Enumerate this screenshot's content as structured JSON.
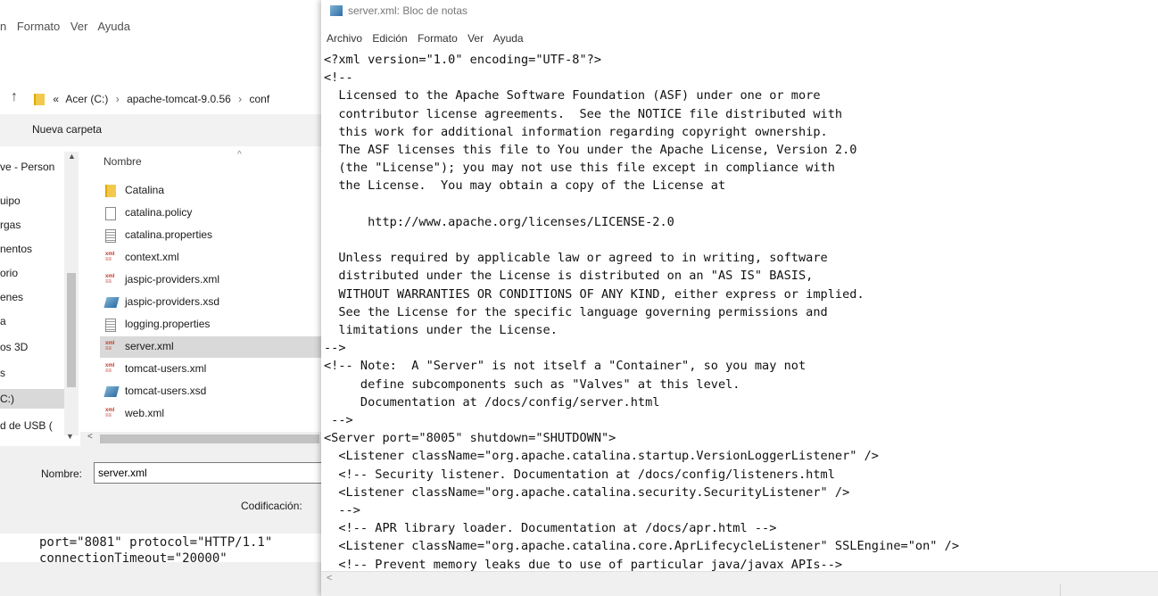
{
  "save_dialog": {
    "menu": [
      "n",
      "Formato",
      "Ver",
      "Ayuda"
    ],
    "breadcrumb": {
      "prefix": "«",
      "items": [
        "Acer (C:)",
        "apache-tomcat-9.0.56",
        "conf"
      ],
      "separator": "›"
    },
    "toolbar": {
      "new_folder": "Nueva carpeta"
    },
    "nav_items": [
      {
        "label": "ve - Person"
      },
      {
        "label": "uipo"
      },
      {
        "label": "rgas"
      },
      {
        "label": "nentos"
      },
      {
        "label": "orio"
      },
      {
        "label": "enes"
      },
      {
        "label": "a"
      },
      {
        "label": "os 3D"
      },
      {
        "label": "s"
      },
      {
        "label": "C:)"
      },
      {
        "label": "d de USB ("
      }
    ],
    "column_header": "Nombre",
    "files": [
      {
        "name": "Catalina",
        "icon": "folder-icon"
      },
      {
        "name": "catalina.policy",
        "icon": "document-icon"
      },
      {
        "name": "catalina.properties",
        "icon": "properties-file-icon"
      },
      {
        "name": "context.xml",
        "icon": "xml-file-icon"
      },
      {
        "name": "jaspic-providers.xml",
        "icon": "xml-file-icon"
      },
      {
        "name": "jaspic-providers.xsd",
        "icon": "xsd-file-icon"
      },
      {
        "name": "logging.properties",
        "icon": "properties-file-icon"
      },
      {
        "name": "server.xml",
        "icon": "xml-file-icon"
      },
      {
        "name": "tomcat-users.xml",
        "icon": "xml-file-icon"
      },
      {
        "name": "tomcat-users.xsd",
        "icon": "xsd-file-icon"
      },
      {
        "name": "web.xml",
        "icon": "xml-file-icon"
      }
    ],
    "selected_file": "server.xml",
    "filename_label": "Nombre:",
    "filename_value": "server.xml",
    "encoding_label": "Codificación:",
    "background_code": [
      "port=\"8081\" protocol=\"HTTP/1.1\"",
      "connectionTimeout=\"20000\""
    ]
  },
  "notepad": {
    "title": "server.xml: Bloc de notas",
    "menu": [
      "Archivo",
      "Edición",
      "Formato",
      "Ver",
      "Ayuda"
    ],
    "lines": [
      "<?xml version=\"1.0\" encoding=\"UTF-8\"?>",
      "<!--",
      "  Licensed to the Apache Software Foundation (ASF) under one or more",
      "  contributor license agreements.  See the NOTICE file distributed with",
      "  this work for additional information regarding copyright ownership.",
      "  The ASF licenses this file to You under the Apache License, Version 2.0",
      "  (the \"License\"); you may not use this file except in compliance with",
      "  the License.  You may obtain a copy of the License at",
      "",
      "      http://www.apache.org/licenses/LICENSE-2.0",
      "",
      "  Unless required by applicable law or agreed to in writing, software",
      "  distributed under the License is distributed on an \"AS IS\" BASIS,",
      "  WITHOUT WARRANTIES OR CONDITIONS OF ANY KIND, either express or implied.",
      "  See the License for the specific language governing permissions and",
      "  limitations under the License.",
      "-->",
      "<!-- Note:  A \"Server\" is not itself a \"Container\", so you may not",
      "     define subcomponents such as \"Valves\" at this level.",
      "     Documentation at /docs/config/server.html",
      " -->",
      "<Server port=\"8005\" shutdown=\"SHUTDOWN\">",
      "  <Listener className=\"org.apache.catalina.startup.VersionLoggerListener\" />",
      "  <!-- Security listener. Documentation at /docs/config/listeners.html",
      "  <Listener className=\"org.apache.catalina.security.SecurityListener\" />",
      "  -->",
      "  <!-- APR library loader. Documentation at /docs/apr.html -->",
      "  <Listener className=\"org.apache.catalina.core.AprLifecycleListener\" SSLEngine=\"on\" />",
      "  <!-- Prevent memory leaks due to use of particular java/javax APIs-->"
    ]
  }
}
